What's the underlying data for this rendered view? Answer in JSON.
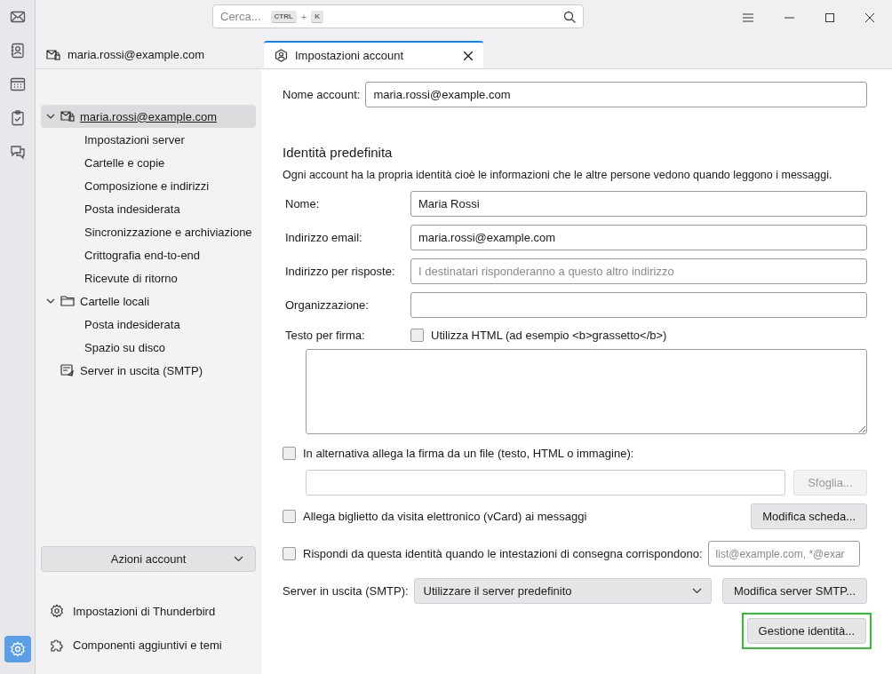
{
  "rail": [
    {
      "kind": "mail",
      "selected": false
    },
    {
      "kind": "contacts",
      "selected": false
    },
    {
      "kind": "calendar",
      "selected": false
    },
    {
      "kind": "tasks",
      "selected": false
    },
    {
      "kind": "chat",
      "selected": false
    },
    {
      "kind": "settings",
      "selected": true
    }
  ],
  "search": {
    "placeholder": "Cerca...",
    "keys": [
      "CTRL",
      "K"
    ],
    "joiner": "+"
  },
  "tabs": [
    {
      "kind": "account",
      "label": "maria.rossi@example.com",
      "selected": false,
      "closable": false
    },
    {
      "kind": "settings",
      "label": "Impostazioni account",
      "selected": true,
      "closable": true
    }
  ],
  "tree": [
    {
      "kind": "account",
      "label": "maria.rossi@example.com",
      "selected": true,
      "expanded": true,
      "children": [
        {
          "label": "Impostazioni server",
          "selected": false
        },
        {
          "label": "Cartelle e copie",
          "selected": false
        },
        {
          "label": "Composizione e indirizzi",
          "selected": false
        },
        {
          "label": "Posta indesiderata",
          "selected": false
        },
        {
          "label": "Sincronizzazione e archiviazione",
          "selected": false
        },
        {
          "label": "Crittografia end-to-end",
          "selected": false
        },
        {
          "label": "Ricevute di ritorno",
          "selected": false
        }
      ]
    },
    {
      "kind": "folder",
      "label": "Cartelle locali",
      "selected": false,
      "expanded": true,
      "children": [
        {
          "label": "Posta indesiderata",
          "selected": false
        },
        {
          "label": "Spazio su disco",
          "selected": false
        }
      ]
    },
    {
      "kind": "outbox",
      "label": "Server in uscita (SMTP)",
      "selected": false
    }
  ],
  "account_actions": {
    "label": "Azioni account"
  },
  "footer_links": [
    {
      "kind": "settings",
      "label": "Impostazioni di Thunderbird"
    },
    {
      "kind": "addons",
      "label": "Componenti aggiuntivi e temi"
    }
  ],
  "form": {
    "account_name": {
      "label": "Nome account:",
      "value": "maria.rossi@example.com"
    },
    "identity": {
      "heading": "Identità predefinita",
      "description": "Ogni account ha la propria identità cioè le informazioni che le altre persone vedono quando leggono i messaggi.",
      "fields": [
        {
          "label": "Nome:",
          "value": "Maria Rossi"
        },
        {
          "label": "Indirizzo email:",
          "value": "maria.rossi@example.com"
        },
        {
          "label": "Indirizzo per risposte:",
          "placeholder": "I destinatari risponderanno a questo altro indirizzo"
        },
        {
          "label": "Organizzazione:"
        }
      ]
    },
    "signature": {
      "label": "Testo per firma:",
      "html_option": "Utilizza HTML (ad esempio <b>grassetto</b>)",
      "html_checked": false
    },
    "signature_file": {
      "label": "In alternativa allega la firma da un file (testo, HTML o immagine):",
      "checked": false,
      "browse": "Sfoglia...",
      "browse_disabled": true
    },
    "vcard": {
      "label": "Allega biglietto da visita elettronico (vCard) ai messaggi",
      "checked": false,
      "button": "Modifica scheda..."
    },
    "reply_from": {
      "label": "Rispondi da questa identità quando le intestazioni di consegna corrispondono:",
      "checked": false,
      "placeholder": "list@example.com, *@exar"
    },
    "smtp": {
      "label": "Server in uscita (SMTP):",
      "value": "Utilizzare il server predefinito",
      "button": "Modifica server SMTP..."
    },
    "manage": {
      "label": "Gestione identità...",
      "highlighted": true
    }
  }
}
